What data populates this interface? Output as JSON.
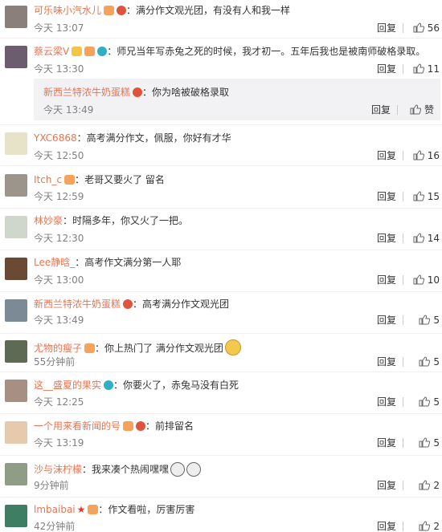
{
  "labels": {
    "reply": "回复",
    "like": "赞"
  },
  "comments": [
    {
      "user": "可乐味小汽水儿",
      "text": "满分作文观光团，有没有人和我一样",
      "time": "今天 13:07",
      "likes": "56"
    },
    {
      "user": "蔡云梁V",
      "text": "师兄当年写赤兔之死的时候，我才初一。五年后我也是被南师破格录取。",
      "time": "今天 13:30",
      "likes": "11",
      "reply": {
        "user": "新西兰特浓牛奶蛋糕",
        "text": "你为啥被破格录取",
        "time": "今天 13:49"
      }
    },
    {
      "user": "YXC6868",
      "text": "高考满分作文，佩服，你好有才华",
      "time": "今天 12:50",
      "likes": "16"
    },
    {
      "user": "Itch_c",
      "text": "老哥又要火了 留名",
      "time": "今天 12:59",
      "likes": "15"
    },
    {
      "user": "林妙豪",
      "text": "时隔多年，你又火了一把。",
      "time": "今天 12:30",
      "likes": "14"
    },
    {
      "user": "Lee静晗_",
      "text": "高考作文满分第一人耶",
      "time": "今天 13:00",
      "likes": "10"
    },
    {
      "user": "新西兰特浓牛奶蛋糕",
      "text": "高考满分作文观光团",
      "time": "今天 13:49",
      "likes": "5"
    },
    {
      "user": "尤物的瘦子",
      "text": "你上热门了 满分作文观光团",
      "time": "55分钟前",
      "likes": "5"
    },
    {
      "user": "这__盛夏的果实",
      "text": "你要火了，赤兔马没有白死",
      "time": "今天 12:25",
      "likes": "5"
    },
    {
      "user": "一个用来看新闻的号",
      "text": "前排留名",
      "time": "今天 13:19",
      "likes": "5"
    },
    {
      "user": "沙与沫柠檬",
      "text": "我来凑个热闹嘿嘿",
      "time": "9分钟前",
      "likes": "2"
    },
    {
      "user": "lmbaibai",
      "text": "作文看啦，厉害厉害",
      "time": "42分钟前",
      "likes": "2"
    }
  ],
  "colors": {
    "username": "#eb7350",
    "time": "#808080",
    "reply_bg": "#f2f2f5"
  }
}
